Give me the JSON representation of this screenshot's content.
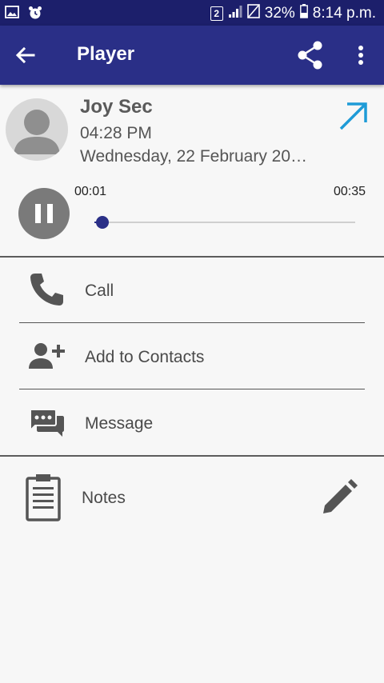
{
  "status_bar": {
    "sim_slot": "2",
    "battery": "32%",
    "time": "8:14 p.m."
  },
  "app_bar": {
    "title": "Player"
  },
  "contact": {
    "name": "Joy Sec",
    "time": "04:28 PM",
    "date": "Wednesday, 22 February 20…"
  },
  "player": {
    "elapsed": "00:01",
    "duration": "00:35",
    "progress_fraction": 0.03
  },
  "actions": [
    {
      "label": "Call",
      "icon": "phone-icon"
    },
    {
      "label": "Add to Contacts",
      "icon": "add-contact-icon"
    },
    {
      "label": "Message",
      "icon": "message-icon"
    }
  ],
  "notes": {
    "label": "Notes"
  },
  "colors": {
    "status_bar": "#1c1f6b",
    "app_bar": "#2a2f87",
    "accent": "#2a2f87",
    "outgoing_arrow": "#1e9bd7"
  }
}
